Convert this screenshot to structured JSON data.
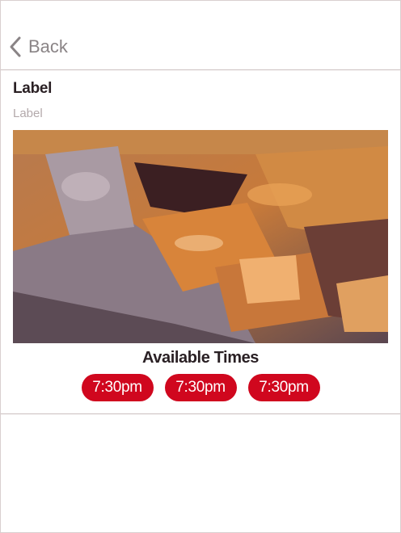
{
  "nav": {
    "back_label": "Back"
  },
  "card": {
    "title": "Label",
    "subtitle": "Label",
    "image_icon": "food-photo",
    "times_heading": "Available Times",
    "times": [
      "7:30pm",
      "7:30pm",
      "7:30pm"
    ]
  },
  "colors": {
    "accent": "#d0071e",
    "text_dark": "#2a2024",
    "text_muted": "#b3a9ab",
    "divider": "#cbbfbf"
  }
}
